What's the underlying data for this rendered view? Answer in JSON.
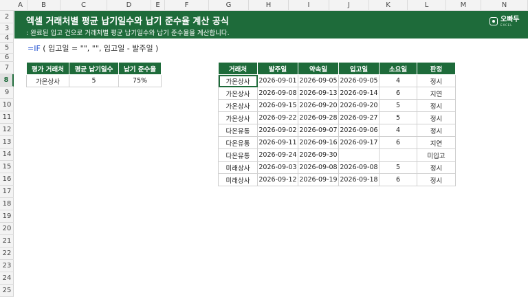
{
  "sheet": {
    "columns": [
      "A",
      "B",
      "C",
      "D",
      "E",
      "F",
      "G",
      "H",
      "I",
      "J",
      "K",
      "L",
      "M",
      "N"
    ],
    "rows": [
      "2",
      "3",
      "4",
      "5",
      "6",
      "7",
      "8",
      "9",
      "10",
      "11",
      "12",
      "13",
      "14",
      "15",
      "16",
      "17",
      "18",
      "19",
      "20",
      "21",
      "22",
      "23",
      "24",
      "25"
    ],
    "active_column": "",
    "active_row": "8"
  },
  "banner": {
    "title": "엑셀 거래처별 평균 납기일수와 납기 준수율 계산 공식",
    "subtitle": ": 완료된 입고 건으로 거래처별 평균 납기일수와 납기 준수율을 계산합니다.",
    "brand_name": "오빠두",
    "brand_tag": "EXCEL",
    "brand_icon": "oppadu-logo-icon"
  },
  "formula": {
    "fn": "=IF",
    "rest": " ( 입고일 = \"\", \"\", 입고일 - 발주일 )"
  },
  "summary": {
    "headers": [
      "평가 거래처",
      "평균 납기일수",
      "납기 준수율"
    ],
    "values": [
      "가온상사",
      "5",
      "75%"
    ]
  },
  "orders": {
    "headers": [
      "거래처",
      "발주일",
      "약속일",
      "입고일",
      "소요일",
      "판정"
    ],
    "rows": [
      [
        "가온상사",
        "2026-09-01",
        "2026-09-05",
        "2026-09-05",
        "4",
        "정시"
      ],
      [
        "가온상사",
        "2026-09-08",
        "2026-09-13",
        "2026-09-14",
        "6",
        "지연"
      ],
      [
        "가온상사",
        "2026-09-15",
        "2026-09-20",
        "2026-09-20",
        "5",
        "정시"
      ],
      [
        "가온상사",
        "2026-09-22",
        "2026-09-28",
        "2026-09-27",
        "5",
        "정시"
      ],
      [
        "다온유통",
        "2026-09-02",
        "2026-09-07",
        "2026-09-06",
        "4",
        "정시"
      ],
      [
        "다온유통",
        "2026-09-11",
        "2026-09-16",
        "2026-09-17",
        "6",
        "지연"
      ],
      [
        "다온유통",
        "2026-09-24",
        "2026-09-30",
        "",
        "",
        "미입고"
      ],
      [
        "미래상사",
        "2026-09-03",
        "2026-09-08",
        "2026-09-08",
        "5",
        "정시"
      ],
      [
        "미래상사",
        "2026-09-12",
        "2026-09-19",
        "2026-09-18",
        "6",
        "정시"
      ]
    ]
  },
  "colors": {
    "accent": "#1e6b3a",
    "formula_fn": "#1f4fd1"
  }
}
